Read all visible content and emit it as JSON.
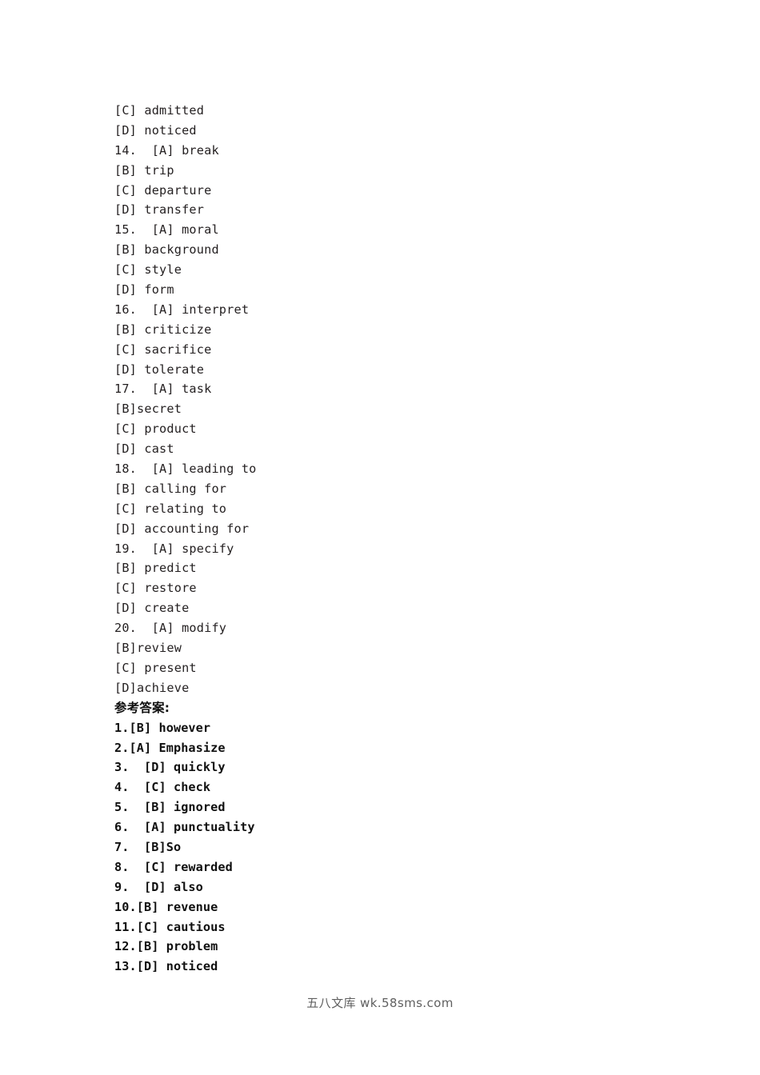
{
  "document": {
    "background_color": "#ffffff",
    "text_color": "#231f20",
    "answer_text_color": "#101010",
    "watermark_color": "#5f5f5f"
  },
  "question_options": [
    {
      "text": "[C] admitted"
    },
    {
      "text": "[D] noticed"
    },
    {
      "text": "14.  [A] break"
    },
    {
      "text": "[B] trip"
    },
    {
      "text": "[C] departure"
    },
    {
      "text": "[D] transfer"
    },
    {
      "text": "15.  [A] moral"
    },
    {
      "text": "[B] background"
    },
    {
      "text": "[C] style"
    },
    {
      "text": "[D] form"
    },
    {
      "text": "16.  [A] interpret"
    },
    {
      "text": "[B] criticize"
    },
    {
      "text": "[C] sacrifice"
    },
    {
      "text": "[D] tolerate"
    },
    {
      "text": "17.  [A] task"
    },
    {
      "text": "[B]secret"
    },
    {
      "text": "[C] product"
    },
    {
      "text": "[D] cast"
    },
    {
      "text": "18.  [A] leading to"
    },
    {
      "text": "[B] calling for"
    },
    {
      "text": "[C] relating to"
    },
    {
      "text": "[D] accounting for"
    },
    {
      "text": "19.  [A] specify"
    },
    {
      "text": "[B] predict"
    },
    {
      "text": "[C] restore"
    },
    {
      "text": "[D] create"
    },
    {
      "text": "20.  [A] modify"
    },
    {
      "text": "[B]review"
    },
    {
      "text": "[C] present"
    },
    {
      "text": "[D]achieve"
    }
  ],
  "answer_section": {
    "heading": "参考答案:",
    "answers": [
      {
        "text": "1.[B] however"
      },
      {
        "text": "2.[A] Emphasize"
      },
      {
        "text": "3.  [D] quickly"
      },
      {
        "text": "4.  [C] check"
      },
      {
        "text": "5.  [B] ignored"
      },
      {
        "text": "6.  [A] punctuality"
      },
      {
        "text": "7.  [B]So"
      },
      {
        "text": "8.  [C] rewarded"
      },
      {
        "text": "9.  [D] also"
      },
      {
        "text": "10.[B] revenue"
      },
      {
        "text": "11.[C] cautious"
      },
      {
        "text": "12.[B] problem"
      },
      {
        "text": "13.[D] noticed"
      }
    ]
  },
  "footer": {
    "watermark": "五八文库 wk.58sms.com"
  }
}
